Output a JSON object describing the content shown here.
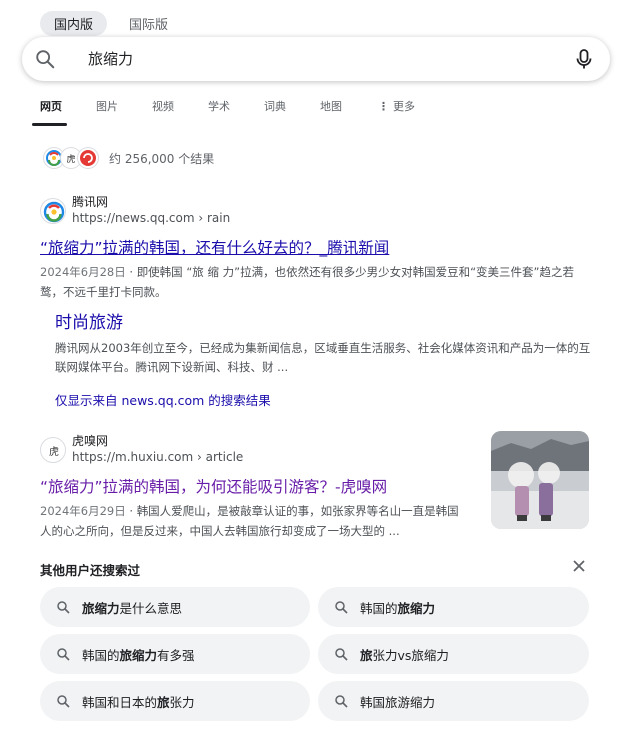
{
  "region_tabs": [
    "国内版",
    "国际版"
  ],
  "search": {
    "query": "旅缩力"
  },
  "nav": [
    "网页",
    "图片",
    "视频",
    "学术",
    "词典",
    "地图",
    "更多"
  ],
  "nav_more_icon": "kebab-icon",
  "stats": {
    "text": "约 256,000 个结果"
  },
  "results": [
    {
      "site_name": "腾讯网",
      "url": "https://news.qq.com › rain",
      "title": "“旅缩力”拉满的韩国，还有什么好去的？_腾讯新闻",
      "date": "2024年6月28日",
      "sep": " · ",
      "snippet": "即使韩国 “旅 缩 力”拉满，也依然还有很多少男少女对韩国爱豆和“变美三件套”趋之若鹜，不远千里打卡同款。"
    },
    {
      "site_name": "虎嗅网",
      "url": "https://m.huxiu.com › article",
      "title": "“旅缩力”拉满的韩国，为何还能吸引游客？-虎嗅网",
      "date": "2024年6月29日",
      "sep": " · ",
      "snippet": "韩国人爱爬山，是被敲章认证的事，如张家界等名山一直是韩国人的心之所向，但是反过来，中国人去韩国旅行却变成了一场大型的 ..."
    }
  ],
  "sitelink": {
    "title": "时尚旅游",
    "snippet": "腾讯网从2003年创立至今，已经成为集新闻信息，区域垂直生活服务、社会化媒体资讯和产品为一体的互联网媒体平台。腾讯网下设新闻、科技、财 ..."
  },
  "more_from": "仅显示来自 news.qq.com 的搜索结果",
  "people_also_search": {
    "title": "其他用户还搜索过",
    "chips": [
      {
        "bold": "旅缩力",
        "rest": "是什么意思",
        "pre": ""
      },
      {
        "pre": "韩国的",
        "bold": "旅缩力",
        "rest": ""
      },
      {
        "pre": "韩国的",
        "bold": "旅缩力",
        "rest": "有多强"
      },
      {
        "pre": "",
        "bold": "旅",
        "rest": "张力vs旅缩力"
      },
      {
        "pre": "韩国和日本的",
        "bold": "旅",
        "rest": "张力"
      },
      {
        "pre": "韩国旅游缩力",
        "bold": "",
        "rest": ""
      }
    ]
  },
  "colors": {
    "link": "#1a0dab",
    "visited": "#681da8",
    "snippet": "#4d5156"
  }
}
